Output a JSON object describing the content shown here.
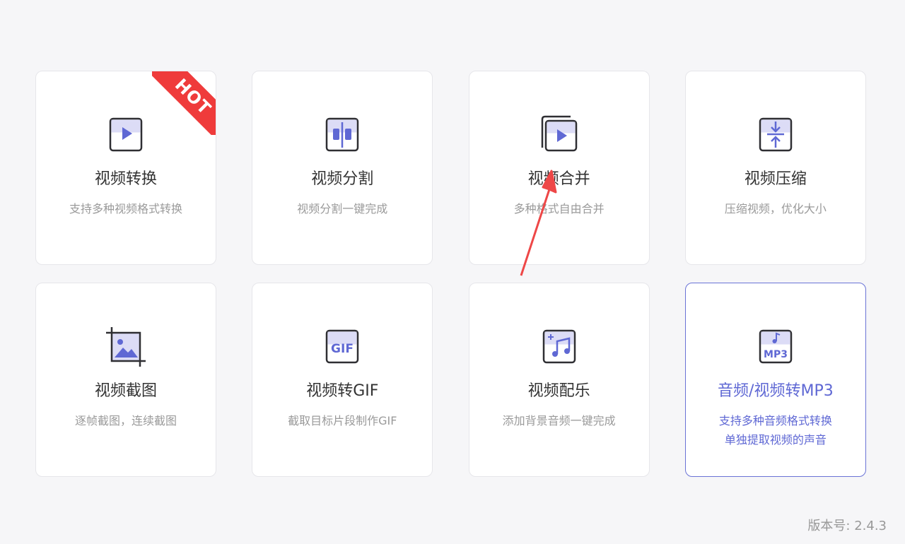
{
  "cards": [
    {
      "title": "视频转换",
      "desc": [
        "支持多种视频格式转换"
      ],
      "icon": "video-convert-icon",
      "badge": "HOT"
    },
    {
      "title": "视频分割",
      "desc": [
        "视频分割一键完成"
      ],
      "icon": "video-split-icon"
    },
    {
      "title": "视频合并",
      "desc": [
        "多种格式自由合并"
      ],
      "icon": "video-merge-icon"
    },
    {
      "title": "视频压缩",
      "desc": [
        "压缩视频，优化大小"
      ],
      "icon": "video-compress-icon"
    },
    {
      "title": "视频截图",
      "desc": [
        "逐帧截图，连续截图"
      ],
      "icon": "video-screenshot-icon"
    },
    {
      "title": "视频转GIF",
      "desc": [
        "截取目标片段制作GIF"
      ],
      "icon": "gif-icon",
      "icon_text": "GIF"
    },
    {
      "title": "视频配乐",
      "desc": [
        "添加背景音频一键完成"
      ],
      "icon": "video-music-icon"
    },
    {
      "title": "音频/视频转MP3",
      "desc": [
        "支持多种音频格式转换",
        "单独提取视频的声音"
      ],
      "icon": "mp3-icon",
      "icon_text": "MP3",
      "active": true
    }
  ],
  "version": "版本号: 2.4.3",
  "colors": {
    "accent": "#5f68d4",
    "icon_fill": "#dcdcf6",
    "icon_stroke": "#2f2f33",
    "hot": "#ef3b3b",
    "arrow": "#ee4747"
  }
}
